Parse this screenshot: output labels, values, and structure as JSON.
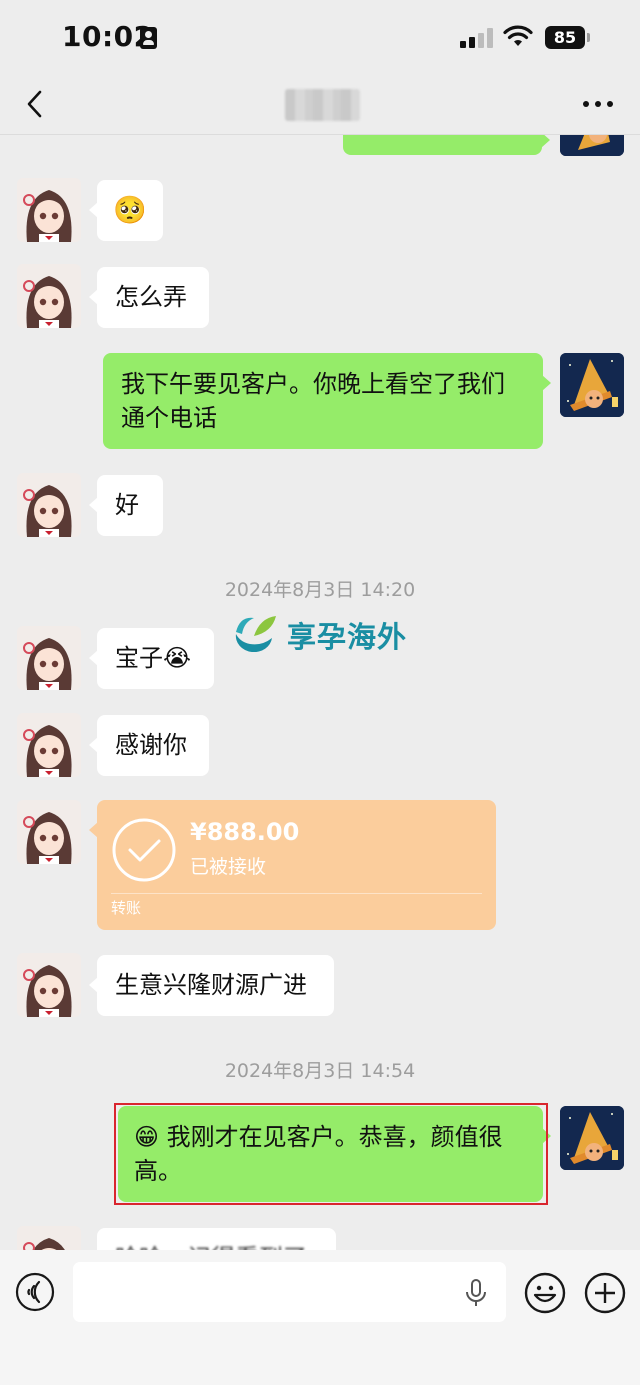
{
  "status_bar": {
    "time": "10:02",
    "battery": "85"
  },
  "nav": {
    "title": "",
    "back_icon": "chevron-left-icon",
    "more_icon": "ellipsis-icon"
  },
  "messages": [
    {
      "side": "left",
      "text": "🥺"
    },
    {
      "side": "left",
      "text": "怎么弄"
    },
    {
      "side": "right",
      "text": "我下午要见客户。你晚上看空了我们通个电话",
      "lines": [
        "我下午要见客户。你晚上看空了我们",
        "通个电话"
      ]
    },
    {
      "side": "left",
      "text": "好"
    },
    {
      "side": "left",
      "text": "宝子😭"
    },
    {
      "side": "left",
      "text": "感谢你"
    },
    {
      "side": "left",
      "text": "生意兴隆财源广进"
    },
    {
      "side": "right",
      "text": "😁 我刚才在见客户。恭喜，颜值很高。",
      "lines": [
        "😁 我刚才在见客户。恭喜，颜值很",
        "高。"
      ]
    },
    {
      "side": "left",
      "text": "哈哈，记得看到了"
    }
  ],
  "timestamps": [
    "2024年8月3日 14:20",
    "2024年8月3日 14:54"
  ],
  "transfer": {
    "amount": "¥888.00",
    "status": "已被接收",
    "label": "转账",
    "color": "#fbcd9c"
  },
  "watermark": {
    "text": "享孕海外"
  },
  "input": {
    "placeholder": ""
  },
  "colors": {
    "self_bubble": "#95ec69",
    "other_bubble": "#ffffff",
    "background": "#ededed",
    "highlight": "#d9252e"
  }
}
